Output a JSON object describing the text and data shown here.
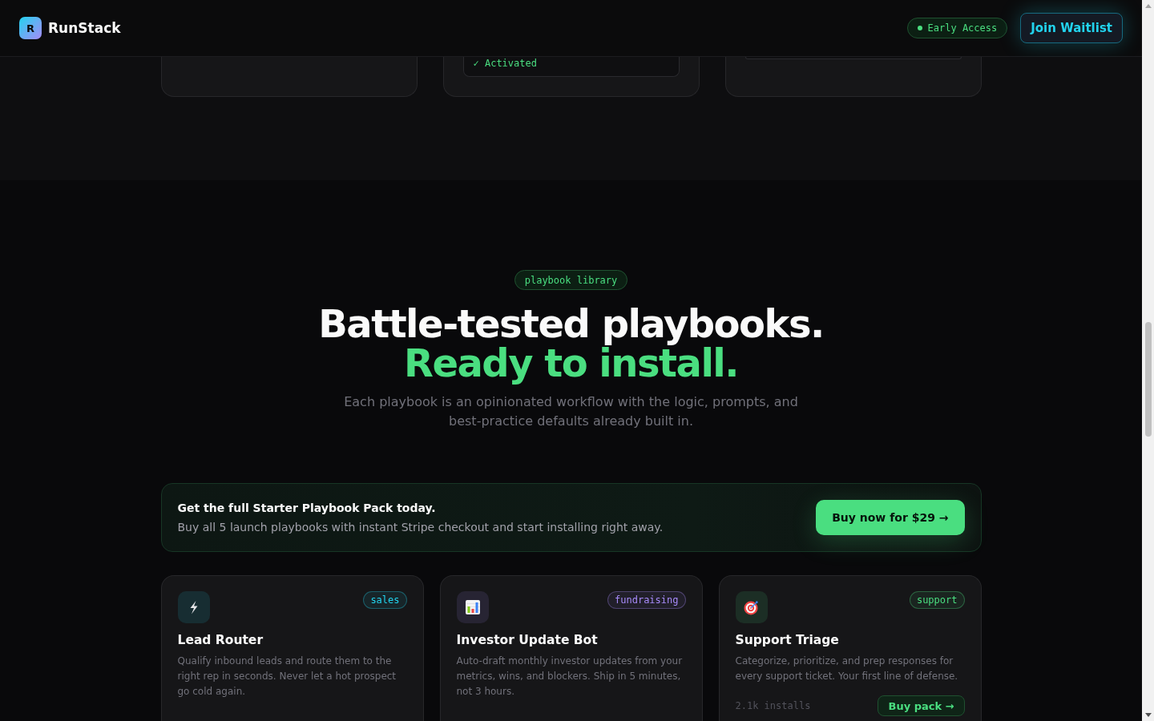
{
  "header": {
    "logo_letter": "R",
    "brand": "RunStack",
    "badge": "Early Access",
    "button": "Join Waitlist"
  },
  "previous_cards": [
    {
      "kind": "empty"
    },
    {
      "kind": "status",
      "status": "✓ Activated"
    },
    {
      "kind": "panel"
    }
  ],
  "hero": {
    "badge": "playbook library",
    "title": "Battle-tested playbooks.",
    "title_accent": "Ready to install.",
    "subtitle": "Each playbook is an opinionated workflow with the logic, prompts, and best-practice defaults already built in."
  },
  "promo": {
    "title": "Get the full Starter Playbook Pack today.",
    "text": "Buy all 5 launch playbooks with instant Stripe checkout and start installing right away.",
    "button": "Buy now for $29 →"
  },
  "playbooks": [
    {
      "name": "Lead Router",
      "tag": "sales",
      "color": "#22d3ee",
      "description": "Qualify inbound leads and route them to the right rep in seconds. Never let a hot prospect go cold again."
    },
    {
      "name": "Investor Update Bot",
      "tag": "fundraising",
      "color": "#a78bfa",
      "description": "Auto-draft monthly investor updates from your metrics, wins, and blockers. Ship in 5 minutes, not 3 hours."
    },
    {
      "name": "Support Triage",
      "tag": "support",
      "color": "#4ade80",
      "description": "Categorize, prioritize, and prep responses for every support ticket. Your first line of defense.",
      "installs": "2.1k installs",
      "button": "Buy pack →"
    }
  ]
}
